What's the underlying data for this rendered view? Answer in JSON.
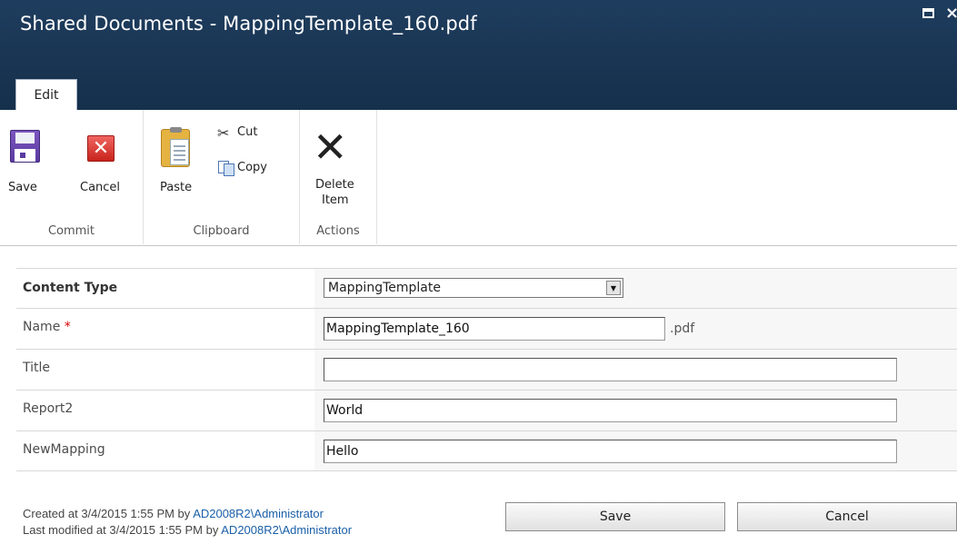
{
  "window": {
    "title": "Shared Documents - MappingTemplate_160.pdf",
    "maximize_glyph": "",
    "close_glyph": "×"
  },
  "ribbon": {
    "active_tab": "Edit",
    "groups": {
      "commit": {
        "label": "Commit",
        "save": "Save",
        "cancel": "Cancel"
      },
      "clipboard": {
        "label": "Clipboard",
        "paste": "Paste",
        "cut": "Cut",
        "copy": "Copy"
      },
      "actions": {
        "label": "Actions",
        "delete_line1": "Delete",
        "delete_line2": "Item"
      }
    }
  },
  "form": {
    "content_type": {
      "label": "Content Type",
      "value": "MappingTemplate"
    },
    "name": {
      "label": "Name",
      "required_marker": "*",
      "value": "MappingTemplate_160",
      "suffix": ".pdf"
    },
    "title": {
      "label": "Title",
      "value": ""
    },
    "report2": {
      "label": "Report2",
      "value": "World"
    },
    "newmapping": {
      "label": "NewMapping",
      "value": "Hello"
    }
  },
  "footer": {
    "created_prefix": "Created at 3/4/2015 1:55 PM  by ",
    "created_by": "AD2008R2\\Administrator",
    "modified_prefix": "Last modified at 3/4/2015 1:55 PM  by ",
    "modified_by": "AD2008R2\\Administrator",
    "save_button": "Save",
    "cancel_button": "Cancel"
  },
  "colors": {
    "title_bar": "#1a3553",
    "link": "#1a5fa8",
    "required": "#dd0000"
  }
}
